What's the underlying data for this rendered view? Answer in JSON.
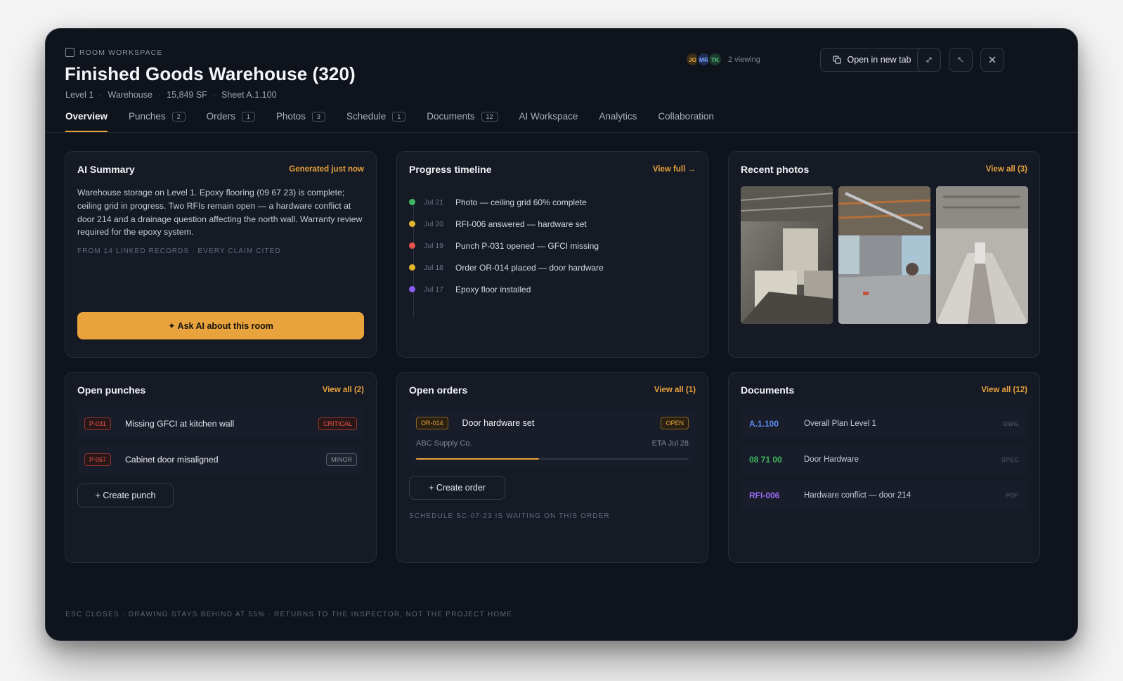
{
  "header": {
    "eyebrow": "ROOM WORKSPACE",
    "title": "Finished Goods Warehouse (320)",
    "meta": [
      "Level 1",
      "Warehouse",
      "15,849 SF",
      "Sheet A.1.100"
    ],
    "meta_separator": "·",
    "viewers": [
      {
        "initials": "JO",
        "bg": "#3a2f1a",
        "fg": "#e8a33c"
      },
      {
        "initials": "MR",
        "bg": "#1f2e52",
        "fg": "#7aa2ff"
      },
      {
        "initials": "TK",
        "bg": "#1c3a2c",
        "fg": "#5cc98d"
      }
    ],
    "viewing_label": "2 viewing",
    "open_new_tab_label": "Open in new tab"
  },
  "tabs": [
    {
      "label": "Overview",
      "badge": null,
      "active": true
    },
    {
      "label": "Punches",
      "badge": "2"
    },
    {
      "label": "Orders",
      "badge": "1"
    },
    {
      "label": "Photos",
      "badge": "3"
    },
    {
      "label": "Schedule",
      "badge": "1"
    },
    {
      "label": "Documents",
      "badge": "12"
    },
    {
      "label": "AI Workspace",
      "badge": null
    },
    {
      "label": "Analytics",
      "badge": null
    },
    {
      "label": "Collaboration",
      "badge": null
    }
  ],
  "ai_summary": {
    "title": "AI Summary",
    "status": "Generated just now",
    "text": "Warehouse storage on Level 1. Epoxy flooring (09 67 23) is complete; ceiling grid in progress. Two RFIs remain open — a hardware conflict at door 214 and a drainage question affecting the north wall. Warranty review required for the epoxy system.",
    "note": "FROM 14 LINKED RECORDS · EVERY CLAIM CITED",
    "ask_label": "✦ Ask AI about this room"
  },
  "timeline": {
    "title": "Progress timeline",
    "link": "View full →",
    "items": [
      {
        "date": "Jul 21",
        "text": "Photo — ceiling grid 60% complete",
        "color": "#3fb65f"
      },
      {
        "date": "Jul 20",
        "text": "RFI-006 answered — hardware set",
        "color": "#e2b62c"
      },
      {
        "date": "Jul 19",
        "text": "Punch P-031 opened — GFCI missing",
        "color": "#e5534b"
      },
      {
        "date": "Jul 18",
        "text": "Order OR-014 placed — door hardware",
        "color": "#e2b62c"
      },
      {
        "date": "Jul 17",
        "text": "Epoxy floor installed",
        "color": "#8b5cf6"
      }
    ]
  },
  "photos": {
    "title": "Recent photos",
    "link": "View all (3)"
  },
  "punches": {
    "title": "Open punches",
    "link": "View all (2)",
    "items": [
      {
        "id": "P-031",
        "text": "Missing GFCI at kitchen wall",
        "severity": "CRITICAL"
      },
      {
        "id": "P-067",
        "text": "Cabinet door misaligned",
        "severity": "MINOR"
      }
    ],
    "create_label": "+ Create punch"
  },
  "orders": {
    "title": "Open orders",
    "link": "View all (1)",
    "item": {
      "id": "OR-014",
      "name": "Door hardware set",
      "status": "OPEN",
      "vendor": "ABC Supply Co.",
      "eta": "ETA Jul 28",
      "progress": 0.45
    },
    "create_label": "+ Create order",
    "note": "SCHEDULE SC-07-23 IS WAITING ON THIS ORDER"
  },
  "documents": {
    "title": "Documents",
    "link": "View all (12)",
    "items": [
      {
        "code": "A.1.100",
        "name": "Overall Plan Level 1",
        "type": "DWG",
        "color": "#5b8def"
      },
      {
        "code": "08 71 00",
        "name": "Door Hardware",
        "type": "SPEC",
        "color": "#3fb65f"
      },
      {
        "code": "RFI-006",
        "name": "Hardware conflict — door 214",
        "type": "PDF",
        "color": "#9b6cf5"
      }
    ]
  },
  "footer": "ESC CLOSES · DRAWING STAYS BEHIND AT 55% · RETURNS TO THE INSPECTOR, NOT THE PROJECT HOME"
}
